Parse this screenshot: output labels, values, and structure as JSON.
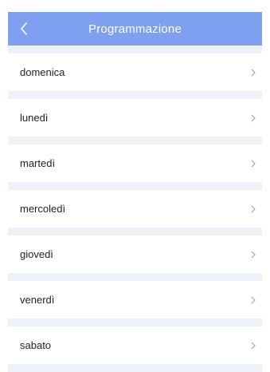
{
  "header": {
    "title": "Programmazione",
    "back_icon": "chevron-left-icon",
    "background": "#7f9ff0"
  },
  "days": [
    {
      "label": "domenica",
      "icon": "chevron-right-icon"
    },
    {
      "label": "lunedì",
      "icon": "chevron-right-icon"
    },
    {
      "label": "martedì",
      "icon": "chevron-right-icon"
    },
    {
      "label": "mercoledì",
      "icon": "chevron-right-icon"
    },
    {
      "label": "giovedì",
      "icon": "chevron-right-icon"
    },
    {
      "label": "venerdì",
      "icon": "chevron-right-icon"
    },
    {
      "label": "sabato",
      "icon": "chevron-right-icon"
    }
  ]
}
